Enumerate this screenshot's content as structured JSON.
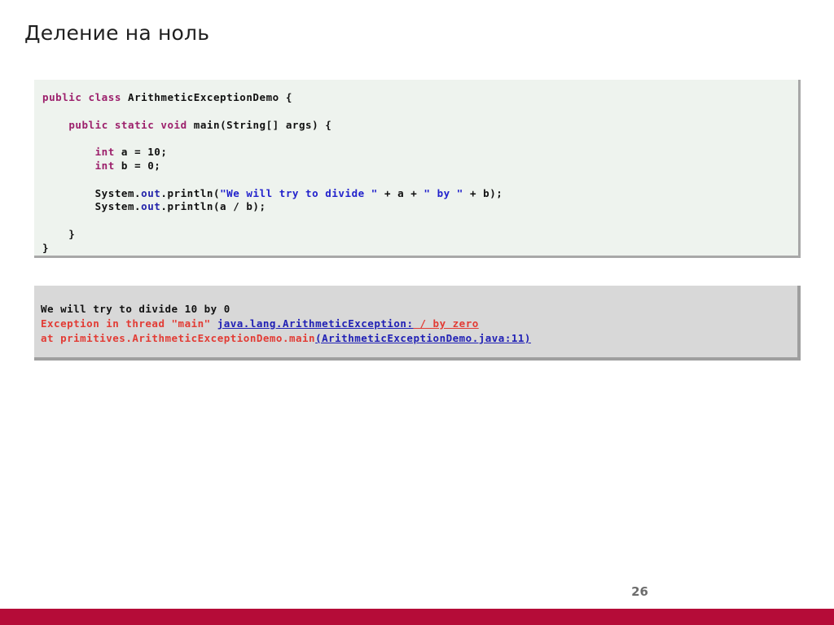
{
  "slide": {
    "title": "Деление на ноль",
    "page_number": "26",
    "accent_color": "#b50c38",
    "code_bg": "#eef3ee",
    "console_bg": "#d8d8d8"
  },
  "code": {
    "lines": [
      [
        {
          "t": "public ",
          "c": "kw"
        },
        {
          "t": "class ",
          "c": "kw"
        },
        {
          "t": "ArithmeticExceptionDemo {",
          "c": "pln"
        }
      ],
      [
        {
          "t": "",
          "c": "pln"
        }
      ],
      [
        {
          "t": "    ",
          "c": "pln"
        },
        {
          "t": "public ",
          "c": "kw"
        },
        {
          "t": "static ",
          "c": "kw"
        },
        {
          "t": "void ",
          "c": "kw"
        },
        {
          "t": "main(String[] args) {",
          "c": "pln"
        }
      ],
      [
        {
          "t": "",
          "c": "pln"
        }
      ],
      [
        {
          "t": "        ",
          "c": "pln"
        },
        {
          "t": "int",
          "c": "kw"
        },
        {
          "t": " a = 10;",
          "c": "pln"
        }
      ],
      [
        {
          "t": "        ",
          "c": "pln"
        },
        {
          "t": "int",
          "c": "kw"
        },
        {
          "t": " b = 0;",
          "c": "pln"
        }
      ],
      [
        {
          "t": "",
          "c": "pln"
        }
      ],
      [
        {
          "t": "        System.",
          "c": "pln"
        },
        {
          "t": "out",
          "c": "fld"
        },
        {
          "t": ".println(",
          "c": "pln"
        },
        {
          "t": "\"We will try to divide \"",
          "c": "str"
        },
        {
          "t": " + a + ",
          "c": "pln"
        },
        {
          "t": "\" by \"",
          "c": "str"
        },
        {
          "t": " + b);",
          "c": "pln"
        }
      ],
      [
        {
          "t": "        System.",
          "c": "pln"
        },
        {
          "t": "out",
          "c": "fld"
        },
        {
          "t": ".println(a / b);",
          "c": "pln"
        }
      ],
      [
        {
          "t": "",
          "c": "pln"
        }
      ],
      [
        {
          "t": "    }",
          "c": "pln"
        }
      ],
      [
        {
          "t": "}",
          "c": "pln"
        }
      ]
    ]
  },
  "console": {
    "lines": [
      [
        {
          "t": "We will try to divide 10 by 0",
          "c": "c-black",
          "u": false
        }
      ],
      [
        {
          "t": "Exception in thread \"main\" ",
          "c": "c-red",
          "u": false
        },
        {
          "t": "java.lang.ArithmeticException:",
          "c": "c-blue",
          "u": true
        },
        {
          "t": " / by zero",
          "c": "c-red",
          "u": true
        }
      ],
      [
        {
          "t": "at primitives.ArithmeticExceptionDemo.main",
          "c": "c-red",
          "u": false
        },
        {
          "t": "(ArithmeticExceptionDemo.java:11)",
          "c": "c-blue",
          "u": true
        }
      ]
    ]
  }
}
